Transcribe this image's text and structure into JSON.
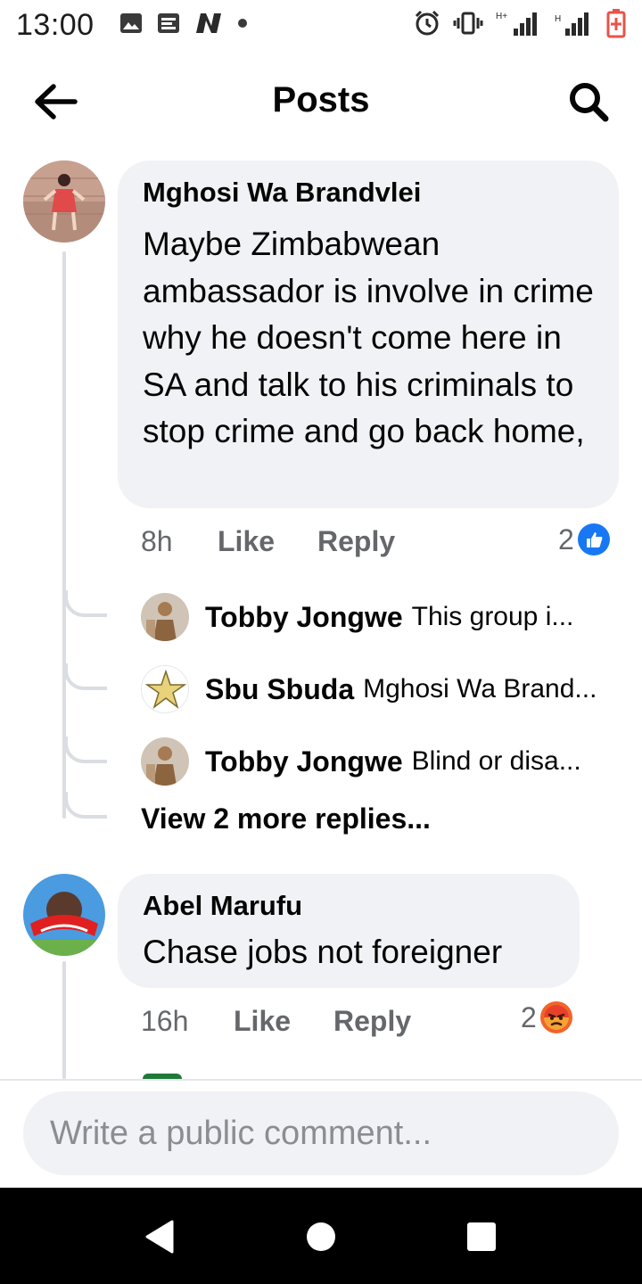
{
  "status_bar": {
    "time": "13:00",
    "left_icons": [
      "image-icon",
      "notes-icon",
      "n-app-icon",
      "dot-icon"
    ],
    "right_icons": [
      "alarm-icon",
      "vibrate-icon",
      "signal-hplus-icon",
      "signal-h-icon",
      "battery-icon"
    ],
    "network_labels": [
      "H+",
      "H"
    ]
  },
  "header": {
    "title": "Posts",
    "back_icon": "arrow-left-icon",
    "search_icon": "search-icon"
  },
  "comments": [
    {
      "author": "Mghosi Wa Brandvlei",
      "text": "Maybe Zimbabwean ambassador is involve in crime why he doesn't come here in SA and talk to his criminals to stop crime and go back home,",
      "time": "8h",
      "like_label": "Like",
      "reply_label": "Reply",
      "reaction_count": "2",
      "reaction_type": "like",
      "replies": [
        {
          "author": "Tobby Jongwe",
          "preview": "This  group  i..."
        },
        {
          "author": "Sbu Sbuda",
          "preview": "Mghosi Wa Brand..."
        },
        {
          "author": "Tobby Jongwe",
          "preview": "Blind  or  disa..."
        }
      ],
      "view_more": "View 2 more replies..."
    },
    {
      "author": "Abel Marufu",
      "text": "Chase jobs not foreigner",
      "time": "16h",
      "like_label": "Like",
      "reply_label": "Reply",
      "reaction_count": "2",
      "reaction_type": "angry"
    }
  ],
  "composer": {
    "placeholder": "Write a public comment..."
  },
  "colors": {
    "bubble": "#f0f2f5",
    "meta_text": "#65676b",
    "like_blue": "#1877f2",
    "angry_orange": "#f0642a"
  }
}
